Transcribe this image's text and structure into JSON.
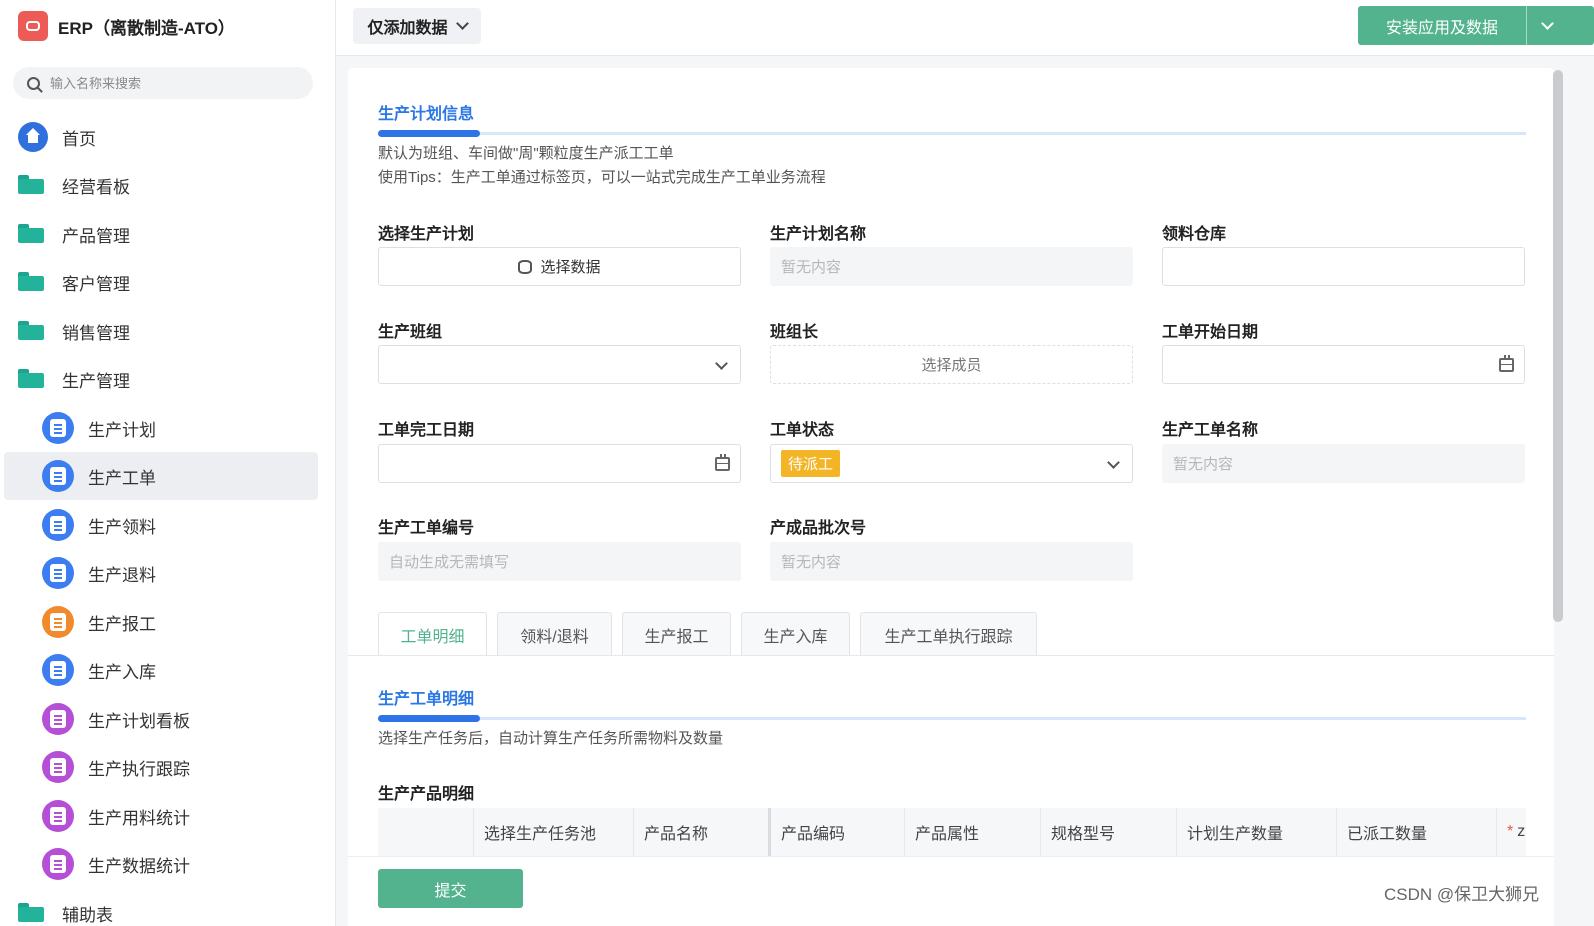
{
  "sidebar": {
    "app_title": "ERP（离散制造-ATO）",
    "search_placeholder": "输入名称来搜索",
    "items": [
      {
        "label": "首页"
      },
      {
        "label": "经营看板"
      },
      {
        "label": "产品管理"
      },
      {
        "label": "客户管理"
      },
      {
        "label": "销售管理"
      },
      {
        "label": "生产管理"
      },
      {
        "label": "生产计划"
      },
      {
        "label": "生产工单"
      },
      {
        "label": "生产领料"
      },
      {
        "label": "生产退料"
      },
      {
        "label": "生产报工"
      },
      {
        "label": "生产入库"
      },
      {
        "label": "生产计划看板"
      },
      {
        "label": "生产执行跟踪"
      },
      {
        "label": "生产用料统计"
      },
      {
        "label": "生产数据统计"
      },
      {
        "label": "辅助表"
      }
    ]
  },
  "topbar": {
    "mode_label": "仅添加数据",
    "install_label": "安装应用及数据"
  },
  "plan_section": {
    "title": "生产计划信息",
    "desc1": "默认为班组、车间做\"周\"颗粒度生产派工工单",
    "desc2": "使用Tips：生产工单通过标签页，可以一站式完成生产工单业务流程"
  },
  "fields": {
    "plan": {
      "label": "选择生产计划",
      "value": "选择数据"
    },
    "plan_name": {
      "label": "生产计划名称",
      "placeholder": "暂无内容"
    },
    "warehouse": {
      "label": "领料仓库"
    },
    "team": {
      "label": "生产班组"
    },
    "leader": {
      "label": "班组长",
      "value": "选择成员"
    },
    "start_date": {
      "label": "工单开始日期"
    },
    "end_date": {
      "label": "工单完工日期"
    },
    "status": {
      "label": "工单状态",
      "value": "待派工"
    },
    "order_name": {
      "label": "生产工单名称",
      "placeholder": "暂无内容"
    },
    "order_no": {
      "label": "生产工单编号",
      "placeholder": "自动生成无需填写"
    },
    "batch_no": {
      "label": "产成品批次号",
      "placeholder": "暂无内容"
    }
  },
  "tabs": [
    {
      "label": "工单明细"
    },
    {
      "label": "领料/退料"
    },
    {
      "label": "生产报工"
    },
    {
      "label": "生产入库"
    },
    {
      "label": "生产工单执行跟踪"
    }
  ],
  "detail_section": {
    "title": "生产工单明细",
    "desc": "选择生产任务后，自动计算生产任务所需物料及数量",
    "table_title": "生产产品明细",
    "columns": [
      "",
      "选择生产任务池",
      "产品名称",
      "产品编码",
      "产品属性",
      "规格型号",
      "计划生产数量",
      "已派工数量",
      "z"
    ]
  },
  "footer": {
    "submit_label": "提交"
  },
  "watermark": "CSDN @保卫大狮兄",
  "colors": {
    "primary_green": "#52b38e",
    "section_blue": "#2a77e5",
    "status_yellow": "#f3b526"
  }
}
